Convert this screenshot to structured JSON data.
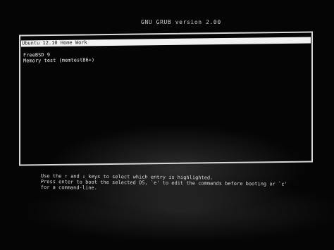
{
  "header": {
    "title": "GNU GRUB  version 2.00"
  },
  "menu": {
    "items": [
      {
        "label": "Ubuntu 12.10 Home Work",
        "selected": true
      },
      {
        "label": "FreeBSD 9",
        "selected": false
      },
      {
        "label": "Memory test (memtest86+)",
        "selected": false
      }
    ]
  },
  "help": {
    "lines": [
      "Use the ↑ and ↓ keys to select which entry is highlighted.",
      "Press enter to boot the selected OS, `e' to edit the commands before booting or `c'",
      "for a command-line."
    ]
  },
  "colors": {
    "background": "#000000",
    "text": "#e6e6e6",
    "highlight": "#f2f2f2"
  }
}
